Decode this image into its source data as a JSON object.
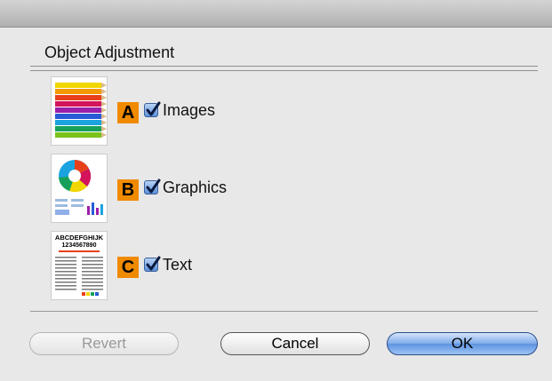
{
  "dialog": {
    "section_title": "Object Adjustment"
  },
  "rows": [
    {
      "marker": "A",
      "label": "Images",
      "checked": true,
      "thumbnail": "colored-pencils-thumbnail"
    },
    {
      "marker": "B",
      "label": "Graphics",
      "checked": true,
      "thumbnail": "graphics-chart-thumbnail"
    },
    {
      "marker": "C",
      "label": "Text",
      "checked": true,
      "thumbnail": "text-document-thumbnail"
    }
  ],
  "thumbnail_text": {
    "line1": "ABCDEFGHIJK",
    "line2": "1234567890"
  },
  "buttons": {
    "revert": "Revert",
    "cancel": "Cancel",
    "ok": "OK"
  },
  "colors": {
    "marker": "#f08a00",
    "checkbox": "#5b8fd6",
    "default_button": "#7eaae8"
  }
}
